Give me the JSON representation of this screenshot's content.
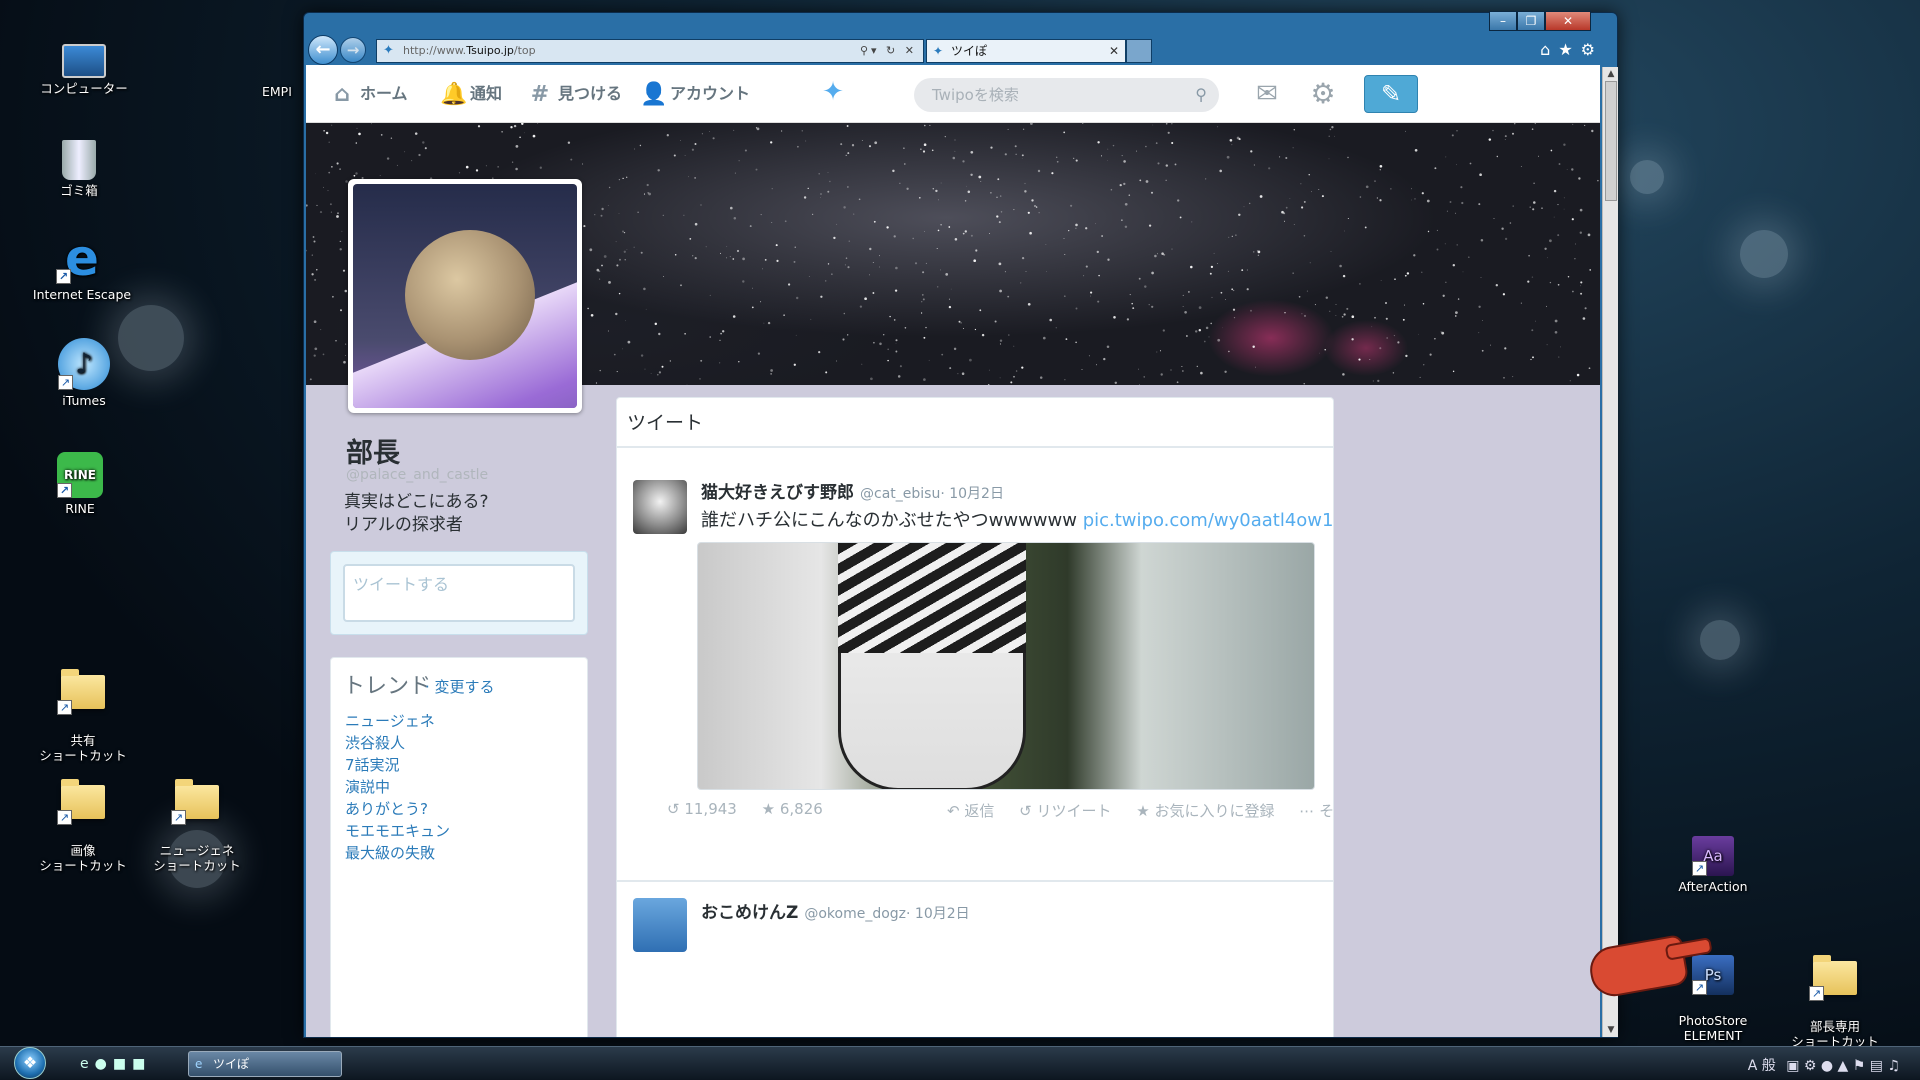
{
  "desktop": {
    "icons": [
      {
        "label": "コンピューター",
        "icon": "computer-icon"
      },
      {
        "label": "ゴミ箱",
        "icon": "trash-icon"
      },
      {
        "label": "Internet Escape",
        "icon": "ie-icon"
      },
      {
        "label": "iTumes",
        "icon": "music-icon"
      },
      {
        "label": "RINE",
        "icon": "chat-icon"
      },
      {
        "label": "共有\nショートカット",
        "icon": "folder-icon"
      },
      {
        "label": "画像\nショートカット",
        "icon": "folder-icon"
      },
      {
        "label": "ニュージェネ\nショートカット",
        "icon": "folder-icon"
      },
      {
        "label": "AfterAction",
        "icon": "app-icon"
      },
      {
        "label": "PhotoStore\nELEMENT",
        "icon": "app-icon"
      },
      {
        "label": "部長専用\nショートカット",
        "icon": "folder-icon"
      }
    ],
    "partial_label": "EMPI"
  },
  "browser": {
    "url_prefix": "http://www.",
    "url_domain": "Tsuipo.jp",
    "url_path": "/top",
    "tab_title": "ツイぽ",
    "window_controls": [
      "–",
      "❐",
      "✕"
    ]
  },
  "nav": {
    "home": "ホーム",
    "notifications": "通知",
    "discover": "見つける",
    "account": "アカウント",
    "search_placeholder": "Twipoを検索"
  },
  "profile": {
    "name": "部長",
    "handle": "@palace_and_castle",
    "bio_line1": "真実はどこにある?",
    "bio_line2": "リアルの探求者",
    "tweet_placeholder": "ツイートする"
  },
  "trends": {
    "title": "トレンド",
    "change": "· 変更する",
    "items": [
      "ニュージェネ",
      "渋谷殺人",
      "7話実況",
      "演説中",
      "ありがとう?",
      "モエモエキュン",
      "最大級の失敗"
    ]
  },
  "stream": {
    "title": "ツイート",
    "tweets": [
      {
        "name": "猫大好きえびす野郎",
        "handle": "@cat_ebisu",
        "date": "· 10月2日",
        "text": "誰だハチ公にこんなのかぶせたやつwwwwww",
        "link": "pic.twipo.com/wy0aatl4ow1",
        "retweets": "11,943",
        "favorites": "6,826",
        "reply": "返信",
        "retweet": "リツイート",
        "favorite": "お気に入りに登録",
        "more": "その他"
      },
      {
        "name": "おこめけんZ",
        "handle": "@okome_dogz",
        "date": "· 10月2日"
      }
    ]
  },
  "taskbar": {
    "task_label": "ツイぽ",
    "tray": "A 般"
  }
}
